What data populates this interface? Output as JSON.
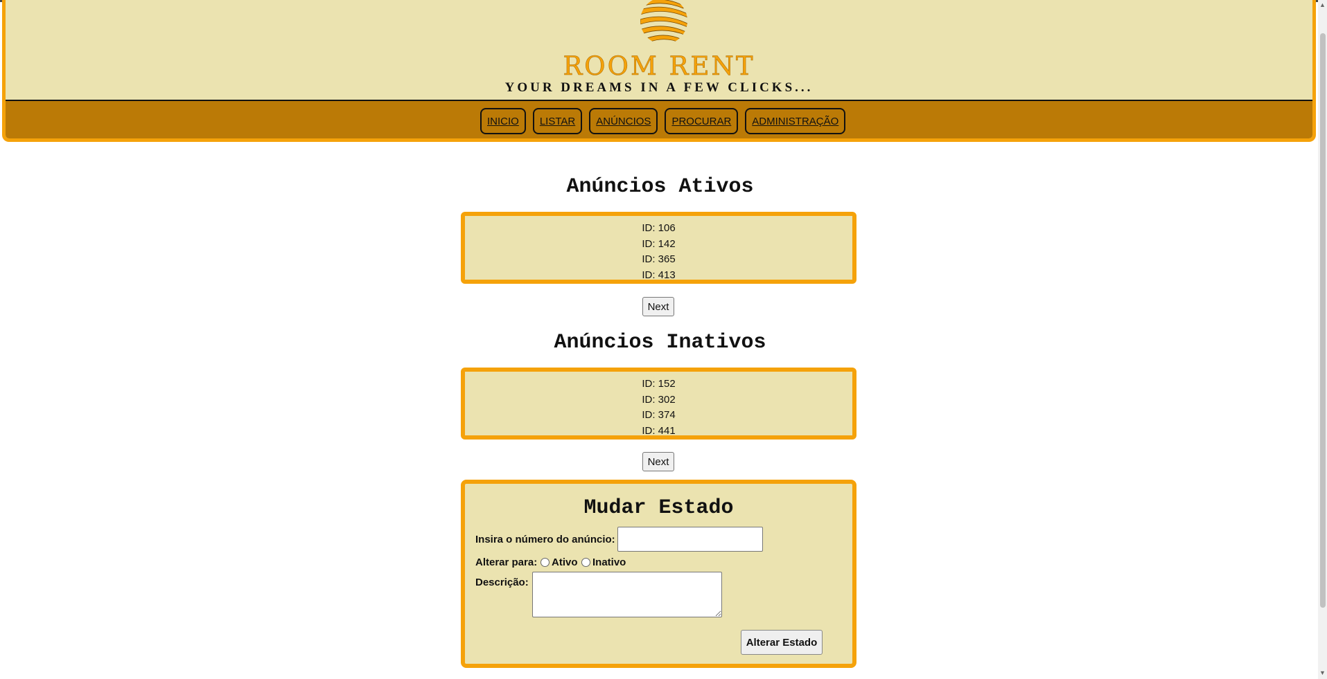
{
  "header": {
    "brand": "ROOM RENT",
    "slogan": "YOUR DREAMS IN A FEW CLICKS...",
    "logo_icon": "sun-stripes-logo",
    "accent_color": "#f5a20a",
    "nav_color": "#bb7a06",
    "panel_color": "#ebe3b0"
  },
  "nav": {
    "items": [
      {
        "label": "INICIO"
      },
      {
        "label": "LISTAR"
      },
      {
        "label": "ANÚNCIOS"
      },
      {
        "label": "PROCURAR"
      },
      {
        "label": "ADMINISTRAÇÃO"
      }
    ]
  },
  "active": {
    "title": "Anúncios Ativos",
    "items": [
      "ID: 106",
      "ID: 142",
      "ID: 365",
      "ID: 413"
    ],
    "next_label": "Next"
  },
  "inactive": {
    "title": "Anúncios Inativos",
    "items": [
      "ID: 152",
      "ID: 302",
      "ID: 374",
      "ID: 441"
    ],
    "next_label": "Next"
  },
  "form": {
    "title": "Mudar Estado",
    "number_label": "Insira o número do anúncio:",
    "number_value": "",
    "alter_label": "Alterar para:",
    "option_active": "Ativo",
    "option_inactive": "Inativo",
    "description_label": "Descrição:",
    "description_value": "",
    "submit_label": "Alterar Estado"
  }
}
